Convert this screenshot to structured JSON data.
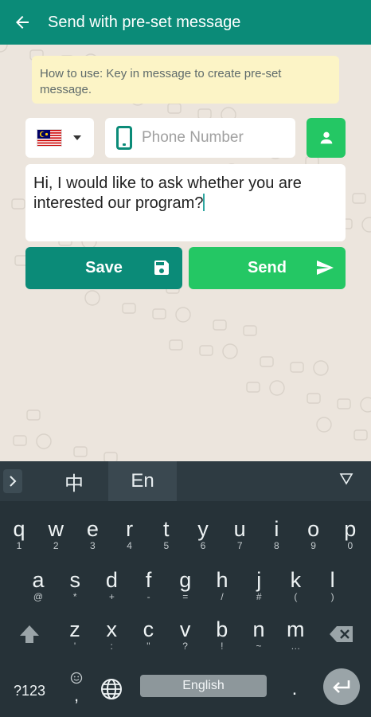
{
  "appbar": {
    "title": "Send with pre-set message",
    "back_icon": "arrow-left-icon"
  },
  "hint": {
    "text": "How to use: Key in message to create pre-set message."
  },
  "country": {
    "flag": "malaysia-flag-icon"
  },
  "phone": {
    "placeholder": "Phone Number",
    "value": ""
  },
  "message": {
    "value": "Hi, I would like to ask whether you are interested our program?"
  },
  "buttons": {
    "save_label": "Save",
    "send_label": "Send"
  },
  "colors": {
    "appbar": "#0b8b78",
    "accent_green": "#24c764",
    "hint_bg": "#fcf4c6",
    "keyboard_bg": "#263238"
  },
  "keyboard": {
    "languages": [
      "中",
      "En"
    ],
    "row1": [
      {
        "k": "q",
        "s": "1"
      },
      {
        "k": "w",
        "s": "2"
      },
      {
        "k": "e",
        "s": "3"
      },
      {
        "k": "r",
        "s": "4"
      },
      {
        "k": "t",
        "s": "5"
      },
      {
        "k": "y",
        "s": "6"
      },
      {
        "k": "u",
        "s": "7"
      },
      {
        "k": "i",
        "s": "8"
      },
      {
        "k": "o",
        "s": "9"
      },
      {
        "k": "p",
        "s": "0"
      }
    ],
    "row2": [
      {
        "k": "a",
        "s": "@"
      },
      {
        "k": "s",
        "s": "*"
      },
      {
        "k": "d",
        "s": "+"
      },
      {
        "k": "f",
        "s": "-"
      },
      {
        "k": "g",
        "s": "="
      },
      {
        "k": "h",
        "s": "/"
      },
      {
        "k": "j",
        "s": "#"
      },
      {
        "k": "k",
        "s": "("
      },
      {
        "k": "l",
        "s": ")"
      }
    ],
    "row3": [
      {
        "k": "z",
        "s": "'"
      },
      {
        "k": "x",
        "s": ":"
      },
      {
        "k": "c",
        "s": "\""
      },
      {
        "k": "v",
        "s": "?"
      },
      {
        "k": "b",
        "s": "!"
      },
      {
        "k": "n",
        "s": "~"
      },
      {
        "k": "m",
        "s": "…"
      }
    ],
    "num_label": "?123",
    "emoji_sub": ",",
    "space_label": "English",
    "period_label": "."
  }
}
